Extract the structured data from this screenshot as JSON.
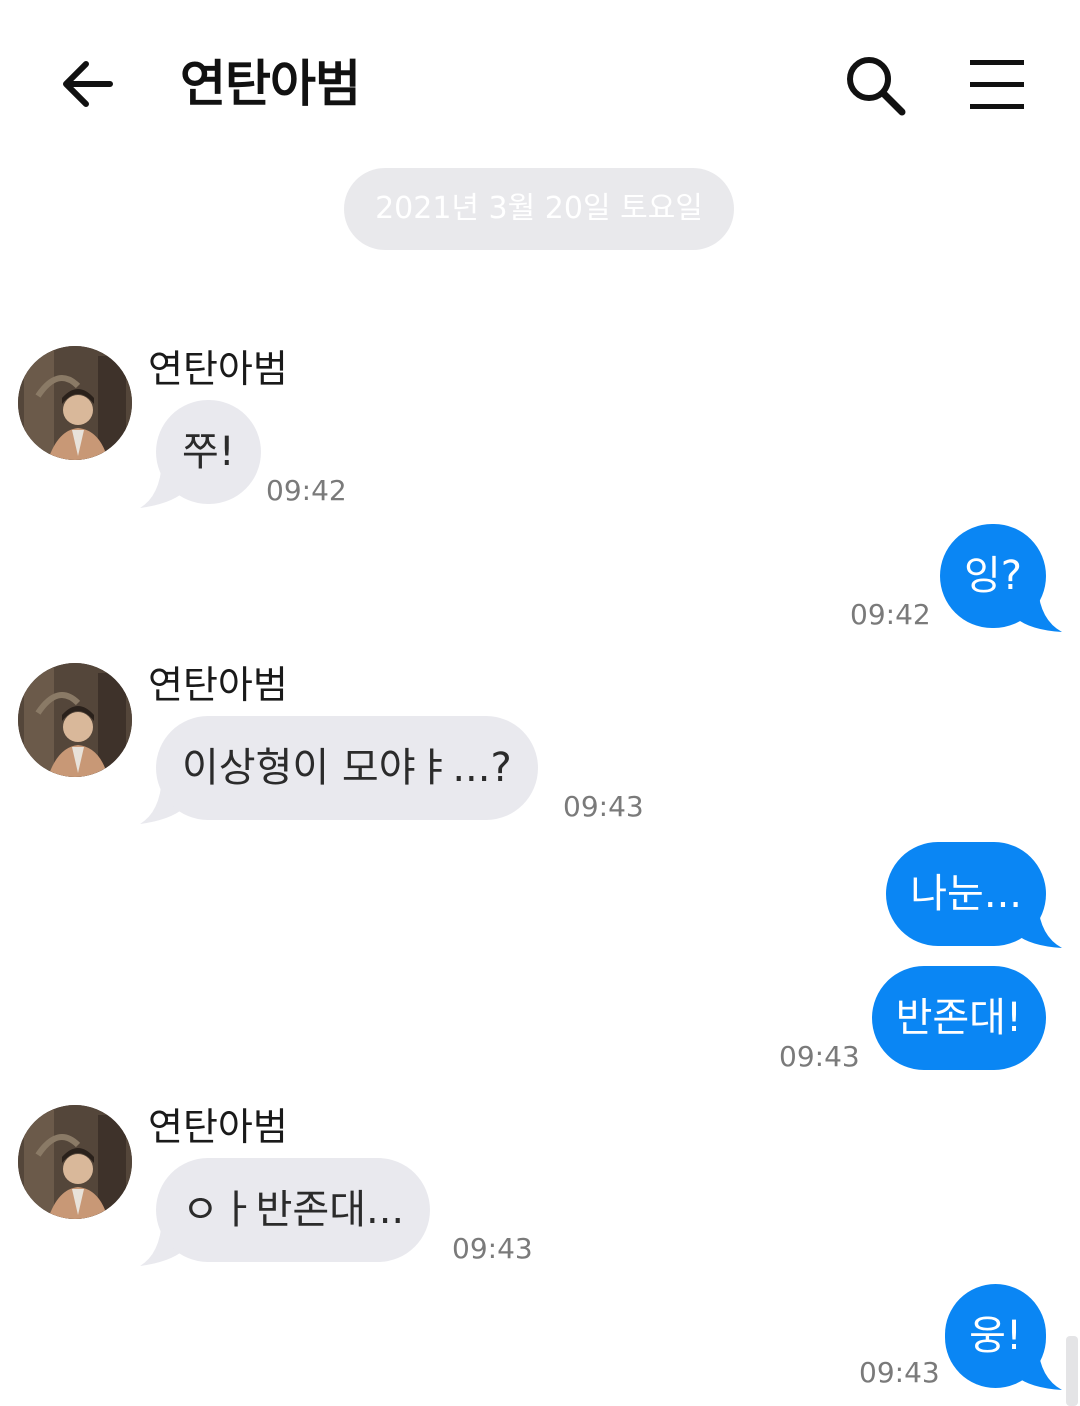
{
  "header": {
    "title": "연탄아범"
  },
  "date_divider": "2021년 3월 20일 토요일",
  "messages": [
    {
      "sender": "연탄아범",
      "text": "쭈!",
      "time": "09:42"
    },
    {
      "text": "잉?",
      "time": "09:42"
    },
    {
      "sender": "연탄아범",
      "text": "이상형이 모야ㅑ...?",
      "time": "09:43"
    },
    {
      "text": "나눈..."
    },
    {
      "text": "반존대!",
      "time": "09:43"
    },
    {
      "sender": "연탄아범",
      "text": "ㅇㅏ반존대...",
      "time": "09:43"
    },
    {
      "text": "웅!",
      "time": "09:43"
    }
  ],
  "colors": {
    "outgoing_bubble": "#0a86f4",
    "incoming_bubble": "#e9e9ee",
    "date_chip": "#e9e9ec"
  },
  "icons": {
    "back": "arrow-left-icon",
    "search": "search-icon",
    "menu": "hamburger-menu-icon"
  }
}
